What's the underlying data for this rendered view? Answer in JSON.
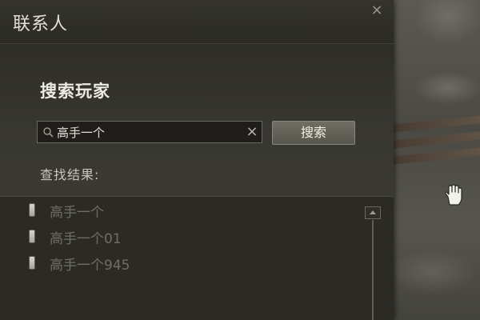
{
  "window": {
    "title": "联系人",
    "close_label": "×"
  },
  "search": {
    "heading": "搜索玩家",
    "input_value": "高手一个",
    "clear_label": "×",
    "button_label": "搜索",
    "results_label": "查找结果:"
  },
  "results": [
    {
      "name": "高手一个"
    },
    {
      "name": "高手一个01"
    },
    {
      "name": "高手一个945"
    }
  ],
  "icons": {
    "search": "search-icon",
    "clear": "close-icon",
    "close": "close-icon",
    "contact": "phone-icon",
    "cursor": "hand-cursor-icon",
    "scroll_up": "chevron-up-icon"
  }
}
